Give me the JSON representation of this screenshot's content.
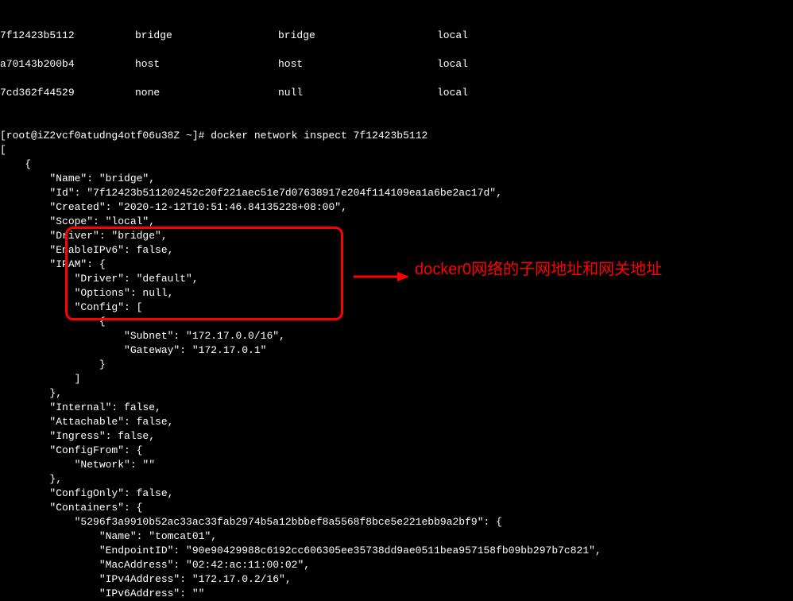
{
  "network_table": {
    "rows": [
      {
        "id": "7f12423b5112",
        "name": "bridge",
        "driver": "bridge",
        "scope": "local"
      },
      {
        "id": "a70143b200b4",
        "name": "host",
        "driver": "host",
        "scope": "local"
      },
      {
        "id": "7cd362f44529",
        "name": "none",
        "driver": "null",
        "scope": "local"
      }
    ]
  },
  "prompt": {
    "text": "[root@iZ2vcf0atudng4otf06u38Z ~]# ",
    "command": "docker network inspect 7f12423b5112"
  },
  "json_output": {
    "line1": "[",
    "line2": "    {",
    "name": "        \"Name\": \"bridge\",",
    "id": "        \"Id\": \"7f12423b511202452c20f221aec51e7d07638917e204f114109ea1a6be2ac17d\",",
    "created": "        \"Created\": \"2020-12-12T10:51:46.84135228+08:00\",",
    "scope": "        \"Scope\": \"local\",",
    "driver": "        \"Driver\": \"bridge\",",
    "enableipv6": "        \"EnableIPv6\": false,",
    "ipam_open": "        \"IPAM\": {",
    "ipam_driver": "            \"Driver\": \"default\",",
    "ipam_options": "            \"Options\": null,",
    "ipam_config_open": "            \"Config\": [",
    "ipam_config_brace": "                {",
    "ipam_subnet": "                    \"Subnet\": \"172.17.0.0/16\",",
    "ipam_gateway": "                    \"Gateway\": \"172.17.0.1\"",
    "ipam_config_close_brace": "                }",
    "ipam_config_close": "            ]",
    "ipam_close": "        },",
    "internal": "        \"Internal\": false,",
    "attachable": "        \"Attachable\": false,",
    "ingress": "        \"Ingress\": false,",
    "configfrom_open": "        \"ConfigFrom\": {",
    "configfrom_network": "            \"Network\": \"\"",
    "configfrom_close": "        },",
    "configonly": "        \"ConfigOnly\": false,",
    "containers_open": "        \"Containers\": {",
    "container_id": "            \"5296f3a9910b52ac33ac33fab2974b5a12bbbef8a5568f8bce5e221ebb9a2bf9\": {",
    "container_name": "                \"Name\": \"tomcat01\",",
    "container_endpoint": "                \"EndpointID\": \"90e90429988c6192cc606305ee35738dd9ae0511bea957158fb09bb297b7c821\",",
    "container_mac": "                \"MacAddress\": \"02:42:ac:11:00:02\",",
    "container_ipv4": "                \"IPv4Address\": \"172.17.0.2/16\",",
    "container_ipv6": "                \"IPv6Address\": \"\""
  },
  "annotation": {
    "text": "docker0网络的子网地址和网关地址"
  }
}
